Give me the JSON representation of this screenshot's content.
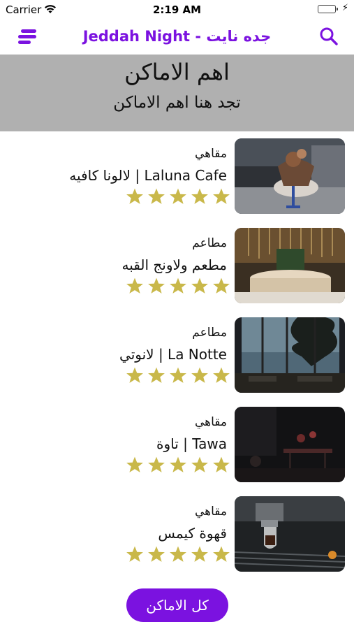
{
  "status_bar": {
    "carrier": "Carrier",
    "time": "2:19 AM"
  },
  "nav": {
    "title": "Jeddah Night - جده نايت",
    "accent_color": "#7b12e0"
  },
  "banner": {
    "heading": "اهم الاماكن",
    "subheading": "تجد هنا اهم الاماكن"
  },
  "places": [
    {
      "category": "مقاهي",
      "name": "لالونا كافيه | Laluna Cafe",
      "rating": 5,
      "image": "dessert-cafe-photo"
    },
    {
      "category": "مطاعم",
      "name": "مطعم ولاونج القبه",
      "rating": 5,
      "image": "lounge-interior-photo"
    },
    {
      "category": "مطاعم",
      "name": "لانوتي | La Notte",
      "rating": 5,
      "image": "restaurant-window-photo"
    },
    {
      "category": "مقاهي",
      "name": "تاوة | Tawa",
      "rating": 5,
      "image": "dark-cafe-photo"
    },
    {
      "category": "مقاهي",
      "name": "قهوة كيمس",
      "rating": 5,
      "image": "espresso-machine-photo"
    }
  ],
  "star_color": "#c9b84a",
  "all_places_button": "كل الاماكن"
}
